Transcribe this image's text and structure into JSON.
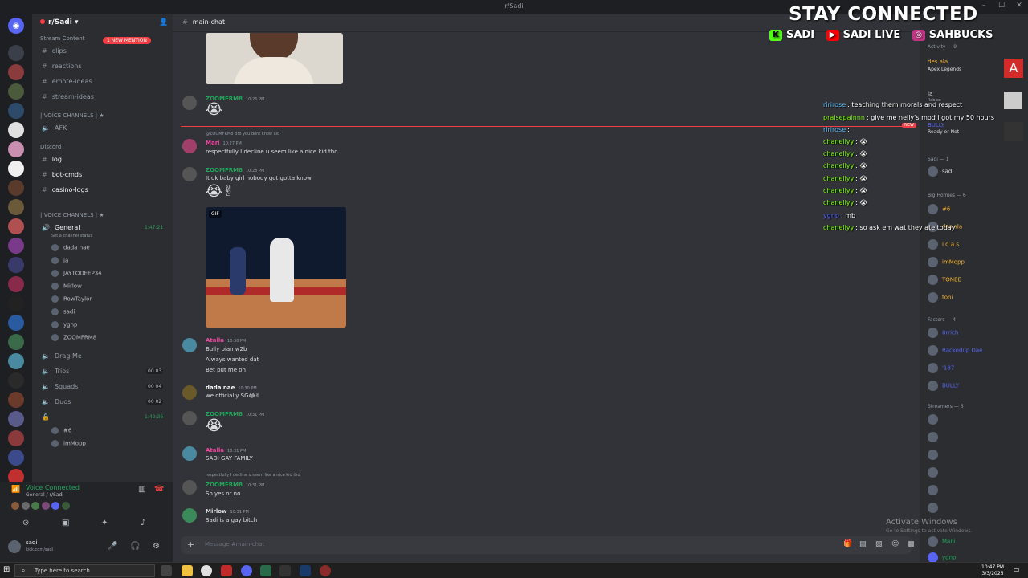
{
  "window": {
    "title": "r/Sadi"
  },
  "server": {
    "name": "r/Sadi",
    "new_mention": "1 NEW MENTION"
  },
  "channels": {
    "stream_content_cat": "Stream Content",
    "items_top": [
      "clips",
      "reactions",
      "emote-ideas",
      "stream-ideas"
    ],
    "voice_cat1": "| VOICE CHANNELS | ★",
    "afk": "AFK",
    "discord_cat": "Discord",
    "items_discord": [
      "log",
      "bot-cmds",
      "casino-logs"
    ],
    "voice_cat2": "| VOICE CHANNELS | ★",
    "general": "General",
    "general_timer": "1:47:21",
    "general_status": "Set a channel status",
    "general_users": [
      "dada nae",
      "ja",
      "JAYTODEEP34",
      "Mirlow",
      "RowTaylor",
      "sadi",
      "ygnp",
      "ZOOMFRM8"
    ],
    "drag_me": "Drag Me",
    "trios": "Trios",
    "trios_count": "00 03",
    "squads": "Squads",
    "squads_count": "00 04",
    "duos": "Duos",
    "duos_count": "00 02",
    "locked_timer": "1:42:36",
    "locked_users": [
      "#6",
      "imMopp"
    ]
  },
  "user_panel": {
    "voice_connected": "Voice Connected",
    "voice_sub": "General / r/Sadi",
    "username": "sadi",
    "status": "kick.com/sadi"
  },
  "chat": {
    "channel": "main-chat",
    "messages": [
      {
        "user": "ZOOMFRM8",
        "time": "10:26 PM",
        "color": "#23a55a",
        "text": "😭"
      },
      {
        "reply": "@ZOOMFRM8 Bro you dont know alo",
        "user": "Mari",
        "time": "10:27 PM",
        "color": "#eb459e",
        "text": "respectfully I decline u seem like a nice kid tho"
      },
      {
        "user": "ZOOMFRM8",
        "time": "10:28 PM",
        "color": "#23a55a",
        "text": "It ok baby girl nobody got gotta know",
        "extra": "😭✌"
      },
      {
        "gif": "GIF"
      },
      {
        "user": "Atalla",
        "time": "10:30 PM",
        "color": "#eb459e",
        "lines": [
          "Bully pian w2b",
          "Always wanted dat",
          "Bet put me on"
        ]
      },
      {
        "user": "dada nae",
        "time": "10:30 PM",
        "color": "#f2f3f5",
        "text": "we officially SG😂✌"
      },
      {
        "user": "ZOOMFRM8",
        "time": "10:31 PM",
        "color": "#23a55a",
        "text": "😭"
      },
      {
        "user": "Atalla",
        "time": "10:31 PM",
        "color": "#eb459e",
        "text": "SADI GAY FAMILY"
      },
      {
        "reply": "respectfully I decline u seem like a nice kid tho",
        "user": "ZOOMFRM8",
        "time": "10:31 PM",
        "color": "#23a55a",
        "text": "So yes or no"
      },
      {
        "user": "Mirlow",
        "time": "10:31 PM",
        "color": "#dbdee1",
        "text": "Sadi is a gay bitch"
      }
    ],
    "new_tag": "NEW",
    "composer_placeholder": "Message #main-chat"
  },
  "members": {
    "activity_cat": "Activity — 9",
    "activity": [
      {
        "name": "des ala",
        "sub": "Apex Legends"
      },
      {
        "name": "ja",
        "sub": "Roblox"
      },
      {
        "name": "BULLY",
        "sub": "Ready or Not"
      }
    ],
    "sadi_cat": "Sadi — 1",
    "sadi": {
      "name": "sadi",
      "sub": "kick.com/sadi"
    },
    "big_cat": "Big Homies — 6",
    "big": [
      {
        "name": "#6",
        "sub": "internet sensation",
        "color": "#f0b232"
      },
      {
        "name": "des ala",
        "sub": "discord.gg/desoak",
        "color": "#f0b232"
      },
      {
        "name": "i d a s",
        "sub": "discord.gg/lifestyle",
        "color": "#f0b232"
      },
      {
        "name": "imMopp",
        "sub": "kick.com/imMopp",
        "color": "#f0b232"
      },
      {
        "name": "TONEE",
        "sub": "Thank God For Everyday",
        "color": "#f0b232"
      },
      {
        "name": "toni",
        "sub": "twitch.com/vibesbytoni",
        "color": "#f0b232"
      }
    ],
    "factors_cat": "Factors — 4",
    "factors": [
      {
        "name": "8rrich",
        "color": "#5865f2"
      },
      {
        "name": "Rackedup Dae",
        "color": "#5865f2"
      },
      {
        "name": "'187",
        "color": "#5865f2"
      },
      {
        "name": "BULLY",
        "sub": "kick.com/wheresbully",
        "color": "#5865f2"
      }
    ],
    "streamers_cat": "Streamers — 6",
    "bottom": [
      {
        "name": "Mani",
        "color": "#23a55a"
      },
      {
        "name": "ygnp",
        "color": "#23a55a"
      }
    ]
  },
  "overlay": {
    "headline": "STAY CONNECTED",
    "kick": "SADI",
    "youtube": "SADI LIVE",
    "instagram": "SAHBUCKS",
    "chat": [
      {
        "name": "ririrose",
        "color": "#5bc0ff",
        "text": ": teaching them morals and respect"
      },
      {
        "name": "praisepainnn",
        "color": "#7cfc00",
        "text": ": give me nelly's mod i got my 50 hours"
      },
      {
        "name": "ririrose",
        "color": "#5bc0ff",
        "text": ":"
      },
      {
        "name": "chanellyy",
        "color": "#7cfc00",
        "text": ": 😭"
      },
      {
        "name": "chanellyy",
        "color": "#7cfc00",
        "text": ": 😭"
      },
      {
        "name": "chanellyy",
        "color": "#7cfc00",
        "text": ": 😭"
      },
      {
        "name": "chanellyy",
        "color": "#7cfc00",
        "text": ": 😭"
      },
      {
        "name": "chanellyy",
        "color": "#7cfc00",
        "text": ": 😭"
      },
      {
        "name": "chanellyy",
        "color": "#7cfc00",
        "text": ": 😭"
      },
      {
        "name": "ygnp",
        "color": "#5865f2",
        "text": ": mb"
      },
      {
        "name": "chanellyy",
        "color": "#7cfc00",
        "text": ": so ask em wat they ate today"
      }
    ]
  },
  "windows_notice": {
    "title": "Activate Windows",
    "sub": "Go to Settings to activate Windows."
  },
  "taskbar": {
    "search": "Type here to search",
    "time": "10:47 PM",
    "date": "3/3/2026"
  }
}
